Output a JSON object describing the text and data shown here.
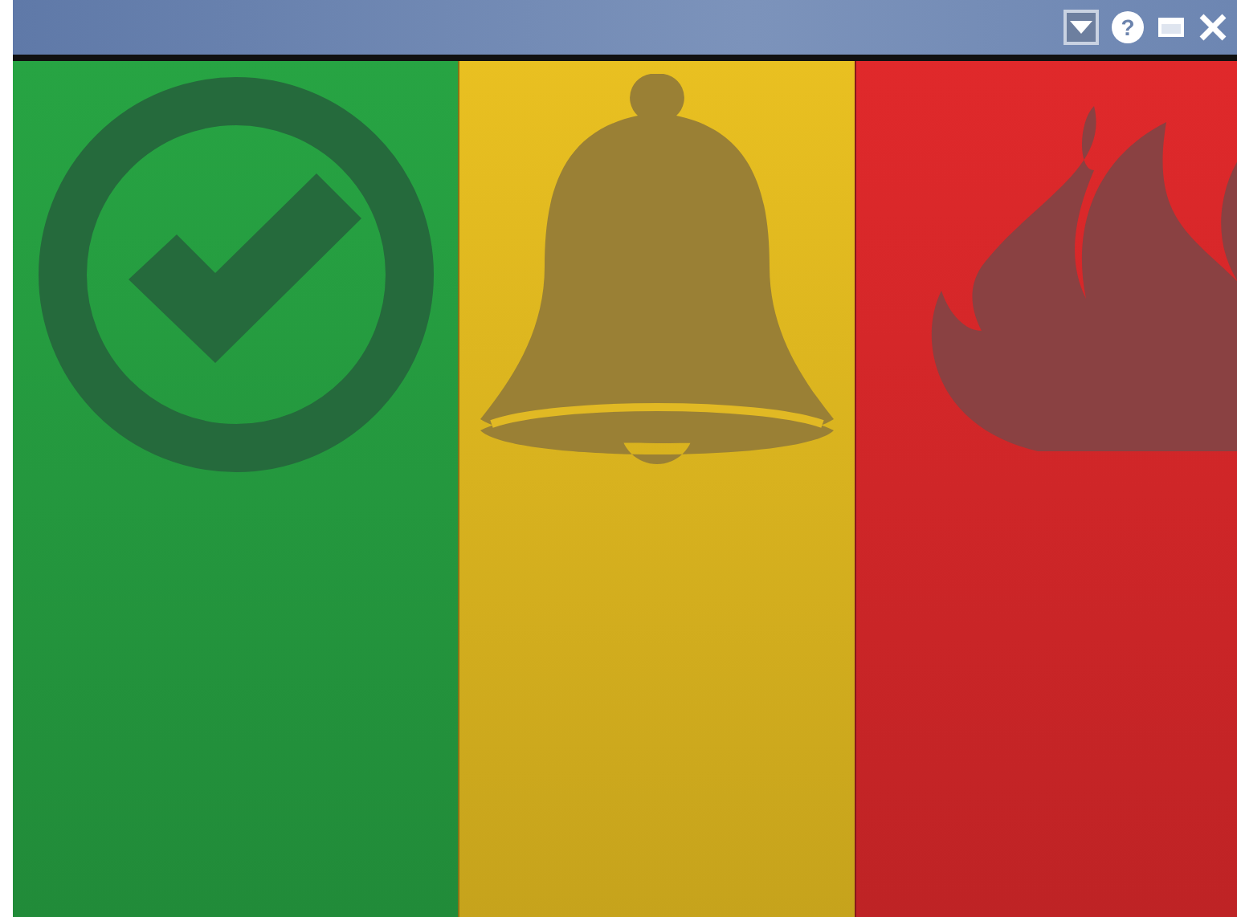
{
  "title_bar": {
    "help_glyph": "?"
  },
  "panels": [
    {
      "kind": "check",
      "color": "#27a443"
    },
    {
      "kind": "bell",
      "color": "#e9c021"
    },
    {
      "kind": "fire",
      "color": "#e0292b"
    }
  ]
}
